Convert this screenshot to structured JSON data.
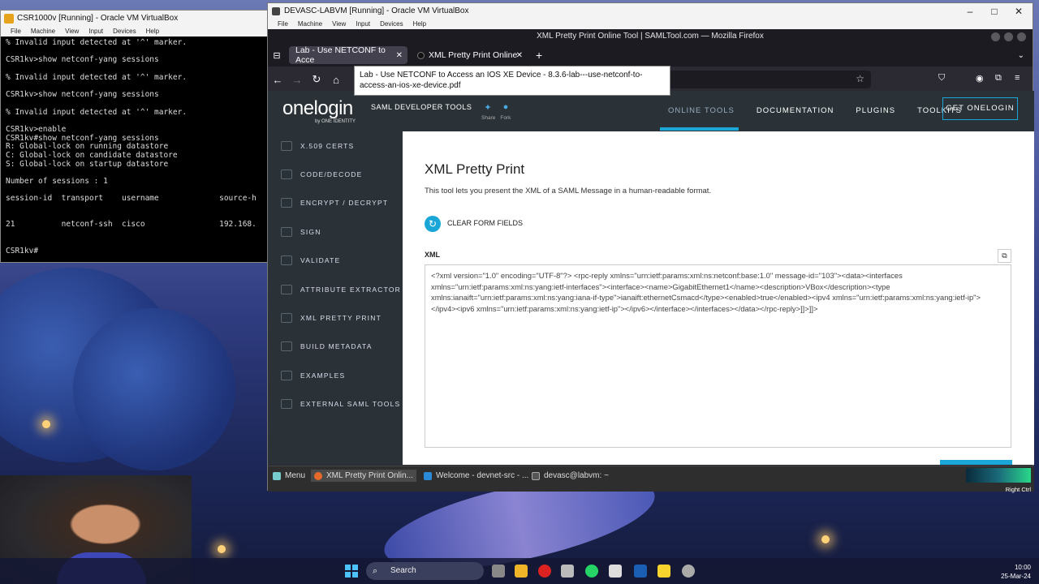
{
  "vb1": {
    "title": "CSR1000v [Running] - Oracle VM VirtualBox",
    "menu": [
      "File",
      "Machine",
      "View",
      "Input",
      "Devices",
      "Help"
    ],
    "terminal_lines": [
      "% Invalid input detected at '^' marker.",
      "",
      "CSR1kv>show netconf-yang sessions",
      "",
      "% Invalid input detected at '^' marker.",
      "",
      "CSR1kv>show netconf-yang sessions",
      "",
      "% Invalid input detected at '^' marker.",
      "",
      "CSR1kv>enable",
      "CSR1kv#show netconf-yang sessions",
      "R: Global-lock on running datastore",
      "C: Global-lock on candidate datastore",
      "S: Global-lock on startup datastore",
      "",
      "Number of sessions : 1",
      "",
      "session-id  transport    username             source-h",
      "",
      "",
      "21          netconf-ssh  cisco                192.168.",
      "",
      "",
      "CSR1kv#"
    ]
  },
  "vb2": {
    "title": "DEVASC-LABVM [Running] - Oracle VM VirtualBox",
    "menu": [
      "File",
      "Machine",
      "View",
      "Input",
      "Devices",
      "Help"
    ],
    "firefox_title": "XML Pretty Print Online Tool | SAMLTool.com — Mozilla Firefox",
    "tabs": [
      {
        "label": "Lab - Use NETCONF to Acce"
      },
      {
        "label": "XML Pretty Print Online"
      }
    ],
    "tooltip": "Lab - Use NETCONF to Access an IOS XE Device - 8.3.6-lab---use-netconf-to-access-an-ios-xe-device.pdf"
  },
  "site": {
    "logo": "onelogin",
    "logo_sub": "by ONE IDENTITY",
    "brand_tools": "SAML DEVELOPER TOOLS",
    "share": "Share",
    "fork": "Fork",
    "nav": [
      "ONLINE TOOLS",
      "DOCUMENTATION",
      "PLUGINS",
      "TOOLKITS"
    ],
    "get_button": "GET ONELOGIN",
    "sidebar": [
      {
        "label": "X.509 CERTS"
      },
      {
        "label": "CODE/DECODE"
      },
      {
        "label": "ENCRYPT / DECRYPT"
      },
      {
        "label": "SIGN"
      },
      {
        "label": "VALIDATE"
      },
      {
        "label": "ATTRIBUTE EXTRACTOR"
      },
      {
        "label": "XML PRETTY PRINT"
      },
      {
        "label": "BUILD METADATA"
      },
      {
        "label": "EXAMPLES"
      },
      {
        "label": "EXTERNAL SAML TOOLS"
      }
    ],
    "heading": "XML Pretty Print",
    "description": "This tool lets you present the XML of a SAML Message in a human-readable format.",
    "clear_label": "CLEAR FORM FIELDS",
    "xml_label": "XML",
    "xml_value": "<?xml version=\"1.0\" encoding=\"UTF-8\"?>\n<rpc-reply xmlns=\"urn:ietf:params:xml:ns:netconf:base:1.0\" message-id=\"103\"><data><interfaces xmlns=\"urn:ietf:params:xml:ns:yang:ietf-interfaces\"><interface><name>GigabitEthernet1</name><description>VBox</description><type xmlns:ianaift=\"urn:ietf:params:xml:ns:yang:iana-if-type\">ianaift:ethernetCsmacd</type><enabled>true</enabled><ipv4 xmlns=\"urn:ietf:params:xml:ns:yang:ietf-ip\"></ipv4><ipv6 xmlns=\"urn:ietf:params:xml:ns:yang:ietf-ip\"></ipv6></interface></interfaces></data></rpc-reply>]]>]]>"
  },
  "guest_taskbar": {
    "menu": "Menu",
    "items": [
      "XML Pretty Print Onlin...",
      "Welcome - devnet-src - ...",
      "devasc@labvm: ~"
    ],
    "right_ctrl": "Right Ctrl"
  },
  "host_taskbar": {
    "search": "Search",
    "time": "10:00",
    "date": "25-Mar-24"
  },
  "colors": {
    "accent": "#1aa7d8",
    "site_dark": "#2a3237",
    "firefox_dark": "#1c1b22"
  }
}
